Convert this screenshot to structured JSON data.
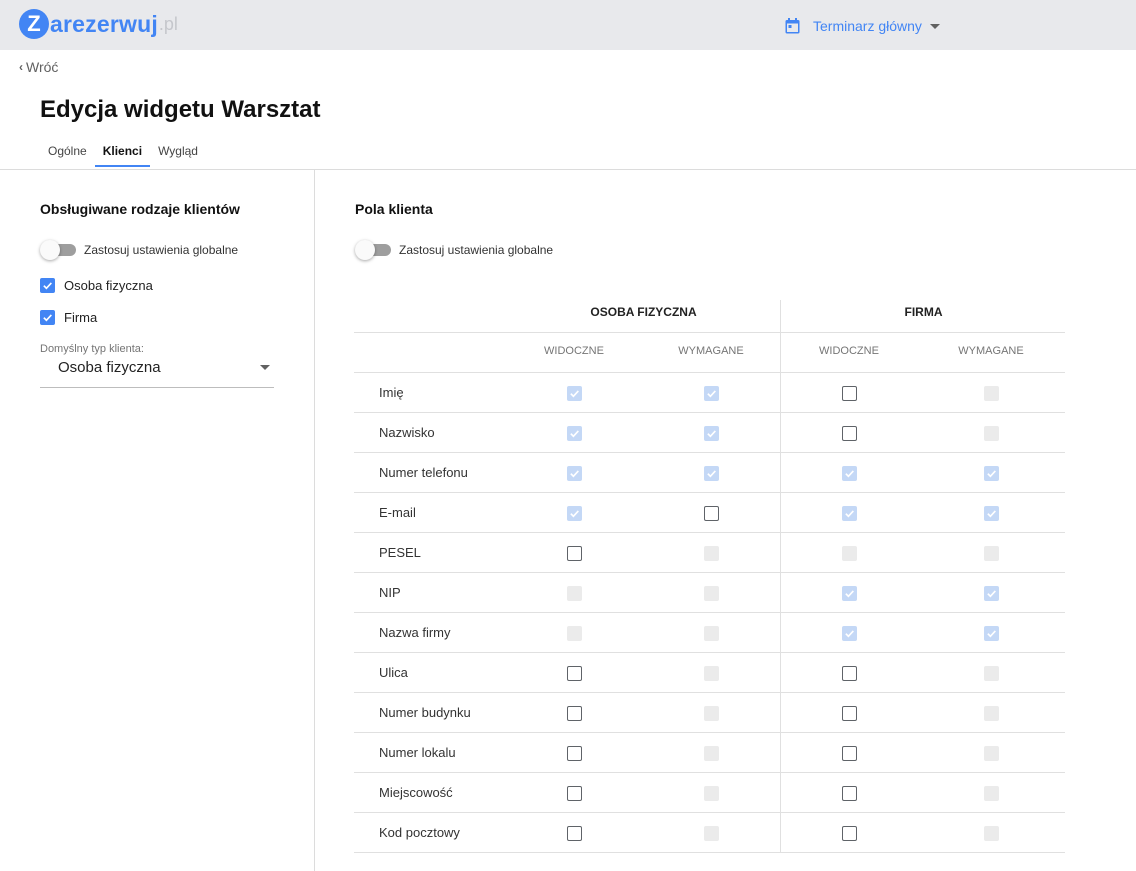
{
  "header": {
    "logo_letter": "Z",
    "logo_text": "arezerwuj",
    "logo_suffix": ".pl",
    "calendar_label": "Terminarz główny"
  },
  "back_label": "Wróć",
  "page_title": "Edycja widgetu Warsztat",
  "tabs": [
    {
      "label": "Ogólne",
      "active": false
    },
    {
      "label": "Klienci",
      "active": true
    },
    {
      "label": "Wygląd",
      "active": false
    }
  ],
  "left": {
    "title": "Obsługiwane rodzaje klientów",
    "toggle_label": "Zastosuj ustawienia globalne",
    "toggle_on": false,
    "client_types": [
      {
        "label": "Osoba fizyczna",
        "checked": true
      },
      {
        "label": "Firma",
        "checked": true
      }
    ],
    "default_type_label": "Domyślny typ klienta:",
    "default_type_value": "Osoba fizyczna"
  },
  "right": {
    "title": "Pola klienta",
    "toggle_label": "Zastosuj ustawienia globalne",
    "toggle_on": false,
    "groups": [
      "OSOBA FIZYCZNA",
      "FIRMA"
    ],
    "columns": [
      "WIDOCZNE",
      "WYMAGANE",
      "WIDOCZNE",
      "WYMAGANE"
    ],
    "rows": [
      {
        "label": "Imię",
        "states": [
          "checked-light",
          "checked-light",
          "empty",
          "disabled"
        ]
      },
      {
        "label": "Nazwisko",
        "states": [
          "checked-light",
          "checked-light",
          "empty",
          "disabled"
        ]
      },
      {
        "label": "Numer telefonu",
        "states": [
          "checked-light",
          "checked-light",
          "checked-light",
          "checked-light"
        ]
      },
      {
        "label": "E-mail",
        "states": [
          "checked-light",
          "empty",
          "checked-light",
          "checked-light"
        ]
      },
      {
        "label": "PESEL",
        "states": [
          "empty",
          "disabled",
          "disabled",
          "disabled"
        ]
      },
      {
        "label": "NIP",
        "states": [
          "disabled",
          "disabled",
          "checked-light",
          "checked-light"
        ]
      },
      {
        "label": "Nazwa firmy",
        "states": [
          "disabled",
          "disabled",
          "checked-light",
          "checked-light"
        ]
      },
      {
        "label": "Ulica",
        "states": [
          "empty",
          "disabled",
          "empty",
          "disabled"
        ]
      },
      {
        "label": "Numer budynku",
        "states": [
          "empty",
          "disabled",
          "empty",
          "disabled"
        ]
      },
      {
        "label": "Numer lokalu",
        "states": [
          "empty",
          "disabled",
          "empty",
          "disabled"
        ]
      },
      {
        "label": "Miejscowość",
        "states": [
          "empty",
          "disabled",
          "empty",
          "disabled"
        ]
      },
      {
        "label": "Kod pocztowy",
        "states": [
          "empty",
          "disabled",
          "empty",
          "disabled"
        ]
      }
    ]
  },
  "colors": {
    "accent": "#4285f4",
    "checked_light": "#c4d8f6",
    "disabled": "#ebebeb",
    "topbar": "#e8e9ec"
  }
}
